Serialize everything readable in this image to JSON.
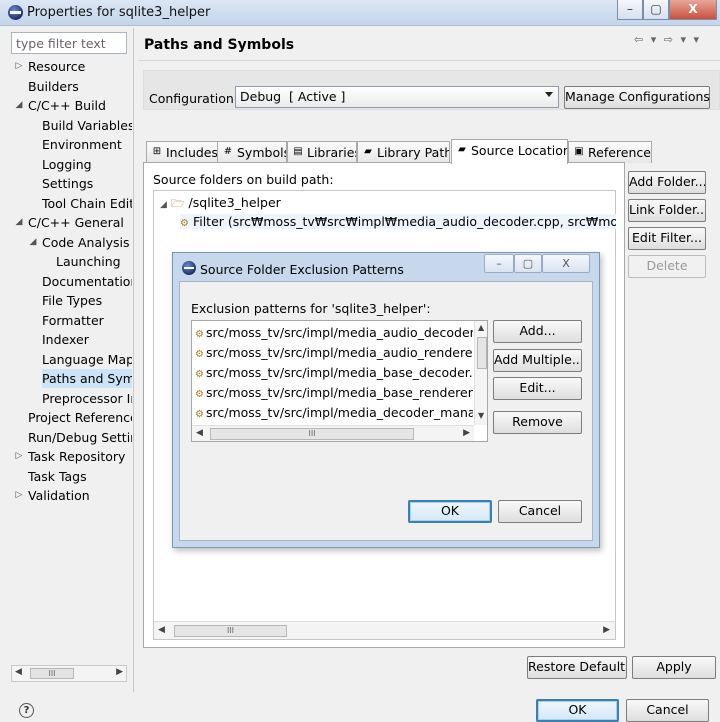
{
  "window": {
    "title": "Properties for sqlite3_helper",
    "controls": [
      "–",
      "▢",
      "X"
    ]
  },
  "filter": {
    "placeholder": "type filter text"
  },
  "tree": [
    {
      "label": "Resource",
      "twisty": "▷"
    },
    {
      "label": "Builders",
      "twisty": ""
    },
    {
      "label": "C/C++ Build",
      "twisty": "◢"
    },
    {
      "label": "Build Variables",
      "twisty": ""
    },
    {
      "label": "Environment",
      "twisty": ""
    },
    {
      "label": "Logging",
      "twisty": ""
    },
    {
      "label": "Settings",
      "twisty": ""
    },
    {
      "label": "Tool Chain Edit",
      "twisty": ""
    },
    {
      "label": "C/C++ General",
      "twisty": "◢"
    },
    {
      "label": "Code Analysis",
      "twisty": "◢"
    },
    {
      "label": "Launching",
      "twisty": ""
    },
    {
      "label": "Documentation",
      "twisty": ""
    },
    {
      "label": "File Types",
      "twisty": ""
    },
    {
      "label": "Formatter",
      "twisty": ""
    },
    {
      "label": "Indexer",
      "twisty": ""
    },
    {
      "label": "Language Map",
      "twisty": ""
    },
    {
      "label": "Paths and Syml",
      "twisty": "",
      "selected": true
    },
    {
      "label": "Preprocessor Ir",
      "twisty": ""
    },
    {
      "label": "Project Reference",
      "twisty": ""
    },
    {
      "label": "Run/Debug Settir",
      "twisty": ""
    },
    {
      "label": "Task Repository",
      "twisty": "▷"
    },
    {
      "label": "Task Tags",
      "twisty": ""
    },
    {
      "label": "Validation",
      "twisty": "▷"
    }
  ],
  "page": {
    "title": "Paths and Symbols",
    "nav": "⇦ ▾ ⇨ ▾ ▾",
    "config_label": "Configuration:",
    "config_value": "Debug  [ Active ]",
    "manage_button": "Manage Configurations..."
  },
  "tabs": [
    {
      "label": "Includes",
      "icon": "⊞"
    },
    {
      "label": "Symbols",
      "icon": "#"
    },
    {
      "label": "Libraries",
      "icon": "▤"
    },
    {
      "label": "Library Paths",
      "icon": "▰"
    },
    {
      "label": "Source Location",
      "icon": "▰",
      "active": true
    },
    {
      "label": "References",
      "icon": "▣"
    }
  ],
  "source_location": {
    "label": "Source folders on build path:",
    "folder": "/sqlite3_helper",
    "filter": "Filter (src₩moss_tv₩src₩impl₩media_audio_decoder.cpp, src₩moss_tv₩src₩",
    "buttons": {
      "add_folder": "Add Folder...",
      "link_folder": "Link Folder...",
      "edit_filter": "Edit Filter...",
      "delete": "Delete"
    }
  },
  "dialog": {
    "title": "Source Folder Exclusion Patterns",
    "label": "Exclusion patterns for 'sqlite3_helper':",
    "patterns": [
      "src/moss_tv/src/impl/media_audio_decoder.cpp",
      "src/moss_tv/src/impl/media_audio_renderer.cpp",
      "src/moss_tv/src/impl/media_base_decoder.cpp",
      "src/moss_tv/src/impl/media_base_renderer.cpp",
      "src/moss_tv/src/impl/media_decoder_manager.cpp"
    ],
    "buttons": {
      "add": "Add...",
      "add_multiple": "Add Multiple...",
      "edit": "Edit...",
      "remove": "Remove",
      "ok": "OK",
      "cancel": "Cancel"
    }
  },
  "footer": {
    "restore_defaults": "Restore Defaults",
    "apply": "Apply",
    "ok": "OK",
    "cancel": "Cancel"
  },
  "scrollbar_grip": "III",
  "colors": {
    "selection": "#cde3f7",
    "default_button_border": "#3c7fb1",
    "dialog_frame": "#c8d8ec"
  }
}
